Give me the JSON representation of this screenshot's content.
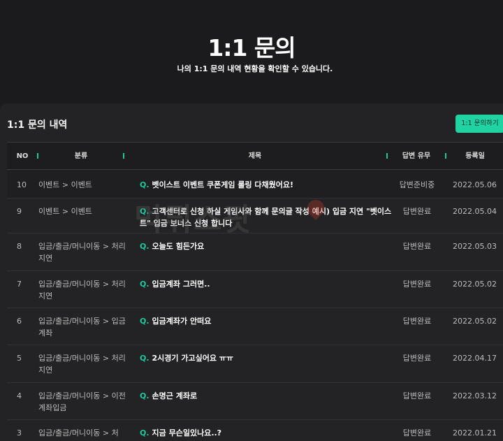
{
  "header": {
    "title": "1:1 문의",
    "subtitle": "나의 1:1 문의 내역 현황을 확인할 수 있습니다."
  },
  "panel": {
    "title": "1:1 문의 내역",
    "inquiry_button": "1:1 문의하기"
  },
  "table": {
    "columns": {
      "no": "NO",
      "category": "분류",
      "title": "제목",
      "status": "답변 유무",
      "date": "등록일"
    },
    "q_prefix": "Q.",
    "rows": [
      {
        "no": "10",
        "category": "이벤트 > 이벤트",
        "title": "벳이스트 이벤트 쿠폰게임 롤링 다채웠어요!",
        "status": "답변준비중",
        "date": "2022.05.06"
      },
      {
        "no": "9",
        "category": "이벤트 > 이벤트",
        "title": "고객센터로 신청 하실 게임사와 함께 문의글 작성 예시) 입금 지연 \"벳이스트\" 입금 보너스 신청 합니다",
        "status": "답변완료",
        "date": "2022.05.04"
      },
      {
        "no": "8",
        "category": "입금/출금/머니이동 > 처리지연",
        "title": "오늘도 힘든가요",
        "status": "답변완료",
        "date": "2022.05.03"
      },
      {
        "no": "7",
        "category": "입금/출금/머니이동 > 처리지연",
        "title": "입금계좌 그러면..",
        "status": "답변완료",
        "date": "2022.05.02"
      },
      {
        "no": "6",
        "category": "입금/출금/머니이동 > 입금계좌",
        "title": "입금계좌가 안떠요",
        "status": "답변완료",
        "date": "2022.05.02"
      },
      {
        "no": "5",
        "category": "입금/출금/머니이동 > 처리지연",
        "title": "2시경기 가고싶어요 ㅠㅠ",
        "status": "답변완료",
        "date": "2022.04.17"
      },
      {
        "no": "4",
        "category": "입금/출금/머니이동 > 이전계좌입금",
        "title": "손명근 계좌로",
        "status": "답변완료",
        "date": "2022.03.12"
      },
      {
        "no": "3",
        "category": "입금/출금/머니이동 > 처",
        "title": "지금 무슨일있나요..?",
        "status": "답변완료",
        "date": "2022.01.21"
      }
    ]
  },
  "watermark": {
    "text": "먹튀스팟",
    "color": "#c0392b"
  },
  "colors": {
    "accent": "#1ec99b",
    "button": "#20d3a3",
    "background": "#1c1c1e"
  }
}
